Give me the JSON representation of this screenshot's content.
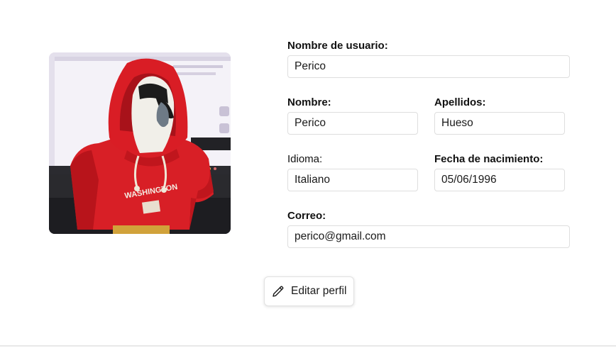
{
  "profile": {
    "photo_subject": "parrot in red hoodie",
    "photo_text": "WASHINGTON"
  },
  "form": {
    "username": {
      "label": "Nombre de usuario:",
      "value": "Perico"
    },
    "first_name": {
      "label": "Nombre:",
      "value": "Perico"
    },
    "last_name": {
      "label": "Apellidos:",
      "value": "Hueso"
    },
    "language": {
      "label": "Idioma:",
      "value": "Italiano"
    },
    "birth_date": {
      "label": "Fecha de nacimiento:",
      "value": "05/06/1996"
    },
    "email": {
      "label": "Correo:",
      "value": "perico@gmail.com"
    }
  },
  "actions": {
    "edit_label": "Editar perfil",
    "edit_icon": "pencil-icon"
  }
}
